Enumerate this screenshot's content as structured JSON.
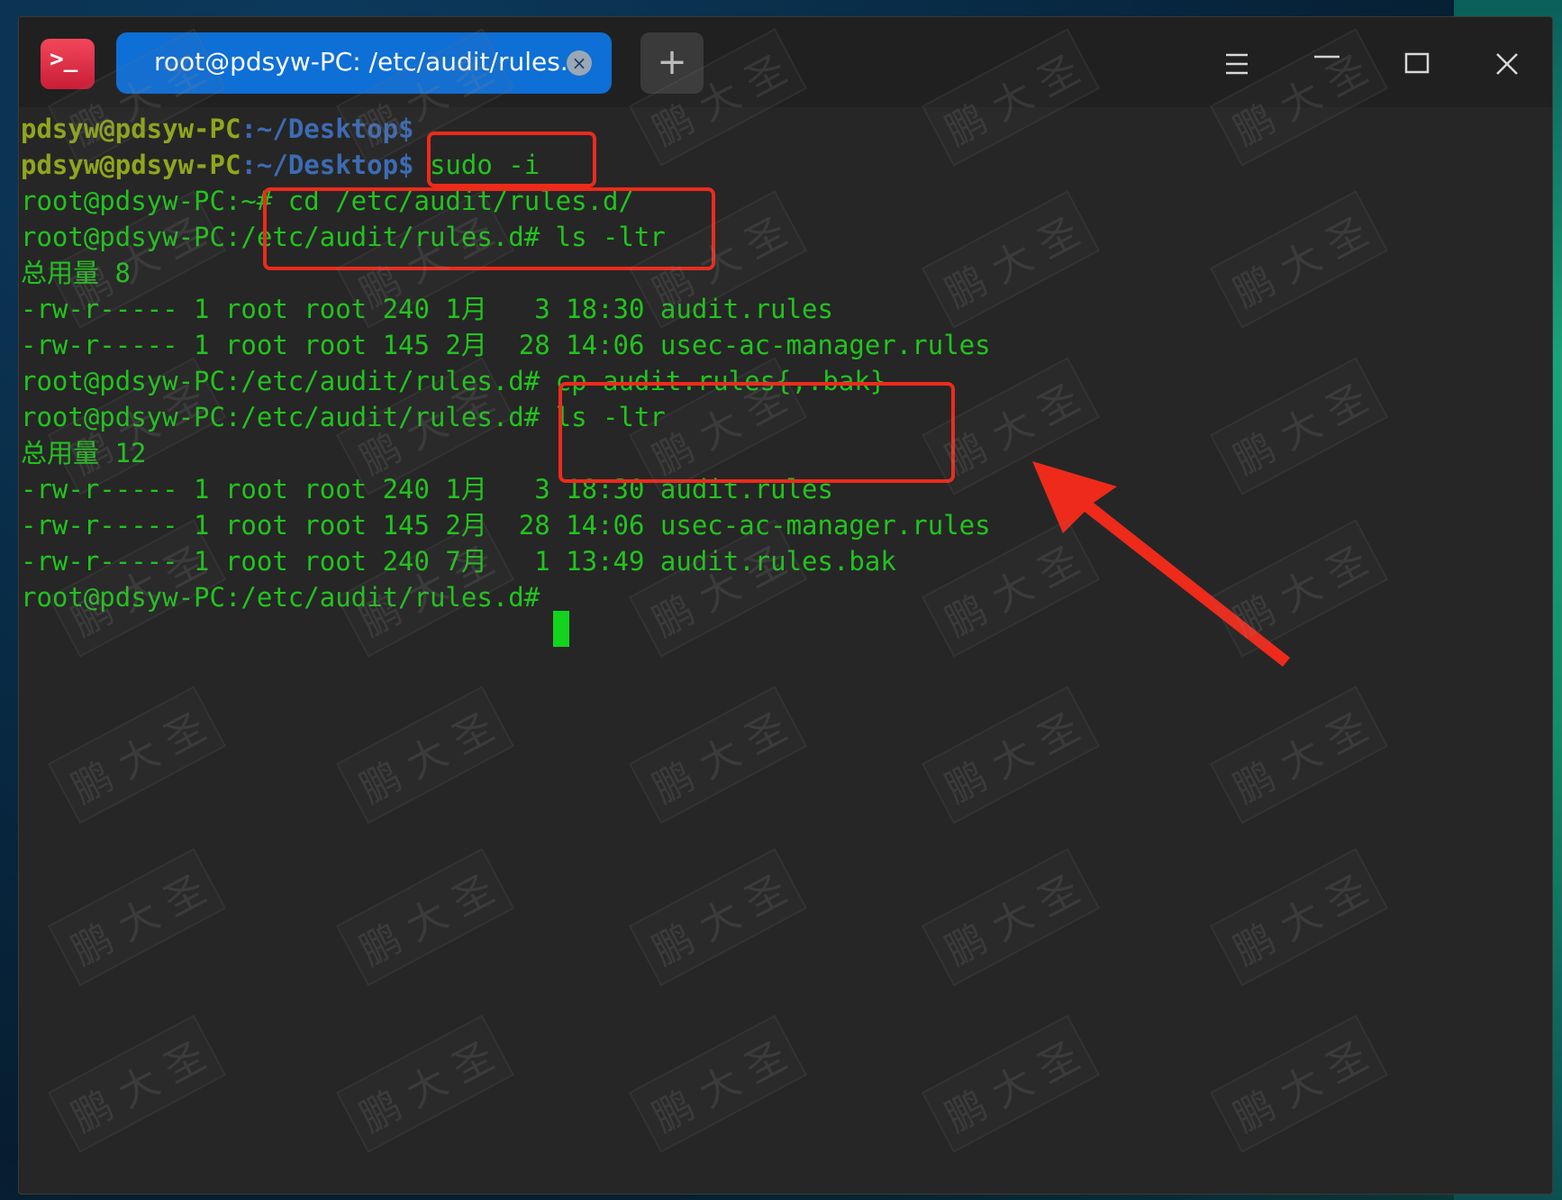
{
  "window": {
    "tab_title": "root@pdsyw-PC: /etc/audit/rules.d",
    "tab_close_symbol": "×",
    "new_tab_symbol": "+",
    "app_icon_text": ">_",
    "icons": [
      "terminal-app-icon",
      "tab-close-icon",
      "new-tab-icon",
      "menu-icon",
      "minimize-icon",
      "maximize-icon",
      "close-icon"
    ]
  },
  "terminal": {
    "lines": [
      {
        "user": "pdsyw@pdsyw-PC",
        "path": ":~/Desktop$",
        "cmd": ""
      },
      {
        "user": "pdsyw@pdsyw-PC",
        "path": ":~/Desktop$",
        "cmd": " sudo -i"
      },
      {
        "text": "root@pdsyw-PC:~# cd /etc/audit/rules.d/"
      },
      {
        "text": "root@pdsyw-PC:/etc/audit/rules.d# ls -ltr"
      },
      {
        "text": "总用量 8"
      },
      {
        "text": "-rw-r----- 1 root root 240 1月   3 18:30 audit.rules"
      },
      {
        "text": "-rw-r----- 1 root root 145 2月  28 14:06 usec-ac-manager.rules"
      },
      {
        "text": "root@pdsyw-PC:/etc/audit/rules.d# cp audit.rules{,.bak}"
      },
      {
        "text": "root@pdsyw-PC:/etc/audit/rules.d# ls -ltr"
      },
      {
        "text": "总用量 12"
      },
      {
        "text": "-rw-r----- 1 root root 240 1月   3 18:30 audit.rules"
      },
      {
        "text": "-rw-r----- 1 root root 145 2月  28 14:06 usec-ac-manager.rules"
      },
      {
        "text": "-rw-r----- 1 root root 240 7月   1 13:49 audit.rules.bak"
      },
      {
        "text": "root@pdsyw-PC:/etc/audit/rules.d# "
      }
    ]
  },
  "watermark_text": "鹏 大 圣",
  "colors": {
    "terminal_bg": "#262626",
    "output_green": "#21c41d",
    "user_olive": "#8fa61c",
    "path_blue": "#3d6bb3",
    "annotation_red": "#ee2a1b",
    "tab_blue": "#0e6fd6"
  }
}
